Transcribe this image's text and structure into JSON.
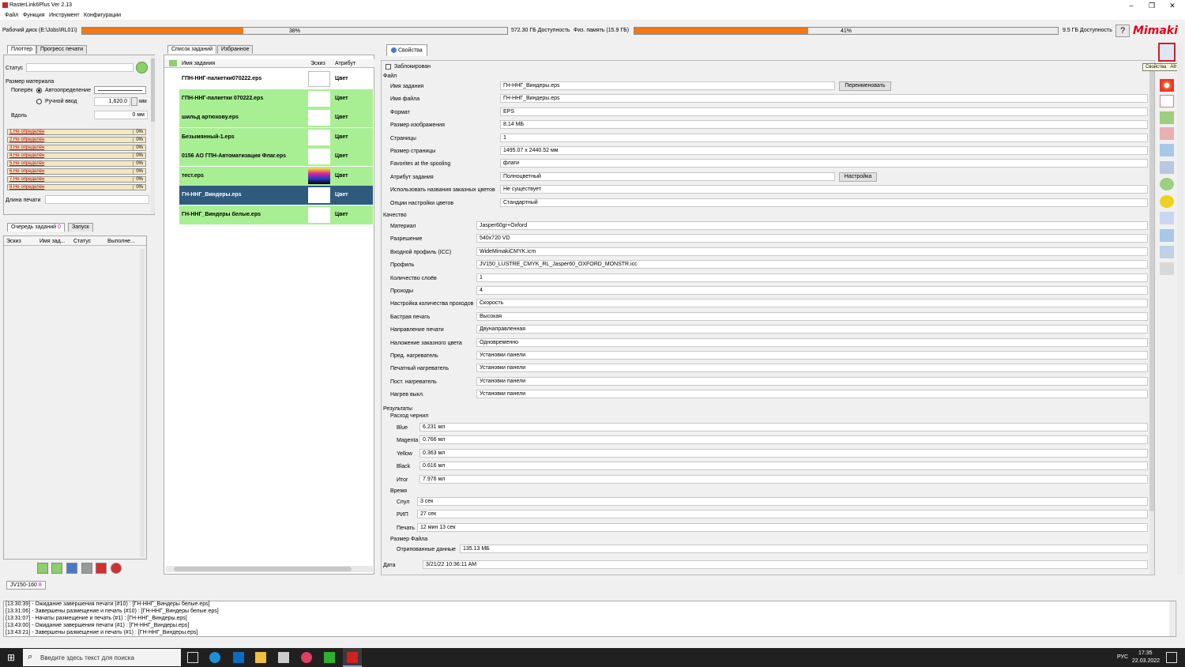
{
  "window": {
    "title": "RasterLink6Plus Ver 2.13"
  },
  "menu": [
    "Файл",
    "Функция",
    "Инструмент",
    "Конфигурации"
  ],
  "disk": {
    "work_label": "Рабочий диск (E:\\Jobs\\RL01\\)",
    "work_pct": "38%",
    "work_pct_value": 38,
    "work_avail": "572.30 ГБ Доступность",
    "mem_label": "Физ. память (15.9 ГБ)",
    "mem_pct": "41%",
    "mem_pct_value": 41,
    "mem_avail": "9.5 ГБ Доступность"
  },
  "brand": "Mimaki",
  "left": {
    "tabs": [
      "Плоттер",
      "Прогресс печати"
    ],
    "status_label": "Статус",
    "material_label": "Размер материала",
    "across_label": "Поперёк",
    "auto_label": "Автоопределение",
    "manual_label": "Ручной ввод",
    "manual_value": "1,620.0",
    "unit": "мм",
    "along_label": "Вдоль",
    "along_value": "0 мм",
    "slots": [
      {
        "name": "1.Не определён",
        "pct": "0%"
      },
      {
        "name": "2.Не определён",
        "pct": "0%"
      },
      {
        "name": "3.Не определён",
        "pct": "0%"
      },
      {
        "name": "4.Не определён",
        "pct": "0%"
      },
      {
        "name": "5.Не определён",
        "pct": "0%"
      },
      {
        "name": "6.Не определён",
        "pct": "0%"
      },
      {
        "name": "7.Не определён",
        "pct": "0%"
      },
      {
        "name": "8.Не определён",
        "pct": "0%"
      }
    ],
    "print_length_label": "Длина печати"
  },
  "queue": {
    "tabs": [
      "Очередь заданий",
      "Запуск"
    ],
    "count": "0",
    "headers": [
      "Эскиз",
      "Имя зад...",
      "Статус",
      "Выполне..."
    ]
  },
  "printer": {
    "name": "JV150-160",
    "count": "8"
  },
  "joblist": {
    "tabs": [
      "Список заданий",
      "Избранное"
    ],
    "headers": [
      "Имя задания",
      "Эскиз",
      "Атрибут"
    ],
    "jobs": [
      {
        "name": "ГПН-ННГ-палкетки070222.eps",
        "attr": "Цвет"
      },
      {
        "name": "ГПН-ННГ-палкетки 070222.eps",
        "attr": "Цвет"
      },
      {
        "name": "шильд артюхову.eps",
        "attr": "Цвет"
      },
      {
        "name": "Безымянный-1.eps",
        "attr": "Цвет"
      },
      {
        "name": "0156 АО ГПН-Автоматизация Флаг.eps",
        "attr": "Цвет"
      },
      {
        "name": "тест.eps",
        "attr": "Цвет"
      },
      {
        "name": "ГН-ННГ_Виндеры.eps",
        "attr": "Цвет"
      },
      {
        "name": "ГН-ННГ_Виндеры белые.eps",
        "attr": "Цвет"
      }
    ]
  },
  "props": {
    "tab": "Свойства",
    "locked_label": "Заблокирован",
    "file_section": "Файл",
    "rename_button": "Переименовать",
    "setup_button": "Настройка",
    "file_rows": [
      {
        "label": "Имя задания",
        "value": "ГН-ННГ_Виндеры.eps"
      },
      {
        "label": "Имя файла",
        "value": "ГН-ННГ_Виндеры.eps"
      },
      {
        "label": "Формат",
        "value": "EPS"
      },
      {
        "label": "Размер изображения",
        "value": "8.14 МБ"
      },
      {
        "label": "Страницы",
        "value": "1"
      },
      {
        "label": "Размер страницы",
        "value": "1495.07 x 2440.52 мм"
      },
      {
        "label": "Favorites at the spooling",
        "value": "флаги"
      },
      {
        "label": "Атрибут задания",
        "value": "Полноцветный"
      },
      {
        "label": "Использовать названия заказных цветов",
        "value": "Не существует"
      },
      {
        "label": "Опции настройки цветов",
        "value": "Стандартный"
      }
    ],
    "quality_section": "Качество",
    "quality_rows": [
      {
        "label": "Материал",
        "value": "Jasper60gr+Oxford"
      },
      {
        "label": "Разрешение",
        "value": "540x720 VD"
      },
      {
        "label": "Входной профиль (ICC)",
        "value": "WideMimakiCMYK.icm"
      },
      {
        "label": "Профиль",
        "value": "JV150_LUSTRE_CMYK_RL_Jasper60_OXFORD_MONSTR.icc"
      },
      {
        "label": "Количество слоёв",
        "value": "1"
      },
      {
        "label": "Проходы",
        "value": "4"
      },
      {
        "label": "Настройка количества проходов",
        "value": "Скорость"
      },
      {
        "label": "Бастрая печать",
        "value": "Высокая"
      },
      {
        "label": "Направление печати",
        "value": "Двунаправленная"
      },
      {
        "label": "Наложение заказного цвета",
        "value": "Одновременно"
      },
      {
        "label": "Пред. нагреватель",
        "value": "Установки панели"
      },
      {
        "label": "Печатный нагреватель",
        "value": "Установки панели"
      },
      {
        "label": "Пост. нагреватель",
        "value": "Установки панели"
      },
      {
        "label": "Нагрев выкл.",
        "value": "Установки панели"
      }
    ],
    "results_section": "Результаты",
    "ink_section": "Расход чернил",
    "ink_rows": [
      {
        "label": "Blue",
        "value": "6.231 мл"
      },
      {
        "label": "Magenta",
        "value": "0.766 мл"
      },
      {
        "label": "Yellow",
        "value": "0.363 мл"
      },
      {
        "label": "Black",
        "value": "0.616 мл"
      },
      {
        "label": "Итог",
        "value": "7.976 мл"
      }
    ],
    "time_section": "Время",
    "time_rows": [
      {
        "label": "Спул",
        "value": "3 сек"
      },
      {
        "label": "РИП",
        "value": "27 сек"
      },
      {
        "label": "Печать",
        "value": "12 мин 13 сек"
      }
    ],
    "size_section": "Размер Файла",
    "size_label": "Отрипованные данные",
    "size_value": "135.13 МБ",
    "date_label": "Дата",
    "date_value": "3/21/22 10:36:11 AM"
  },
  "tooltip": "Свойства : Alt+I",
  "log": [
    "[13:30:39] - Ожидание завершения печати (#10) : [ГН-ННГ_Виндеры белые.eps]",
    "[13:31:06] - Завершены размещение и печать (#10) : [ГН-ННГ_Виндеры белые.eps]",
    "[13:31:07] - Начаты размещение и печать (#1) : [ГН-ННГ_Виндеры.eps]",
    "[13:43:00] - Ожидание завершения печати (#1) : [ГН-ННГ_Виндеры.eps]",
    "[13:43:21] - Завершены размещение и печать (#1) : [ГН-ННГ_Виндеры.eps]"
  ],
  "taskbar": {
    "search": "Введите здесь текст для поиска",
    "lang": "РУС",
    "time": "17:35",
    "date": "22.03.2022"
  }
}
